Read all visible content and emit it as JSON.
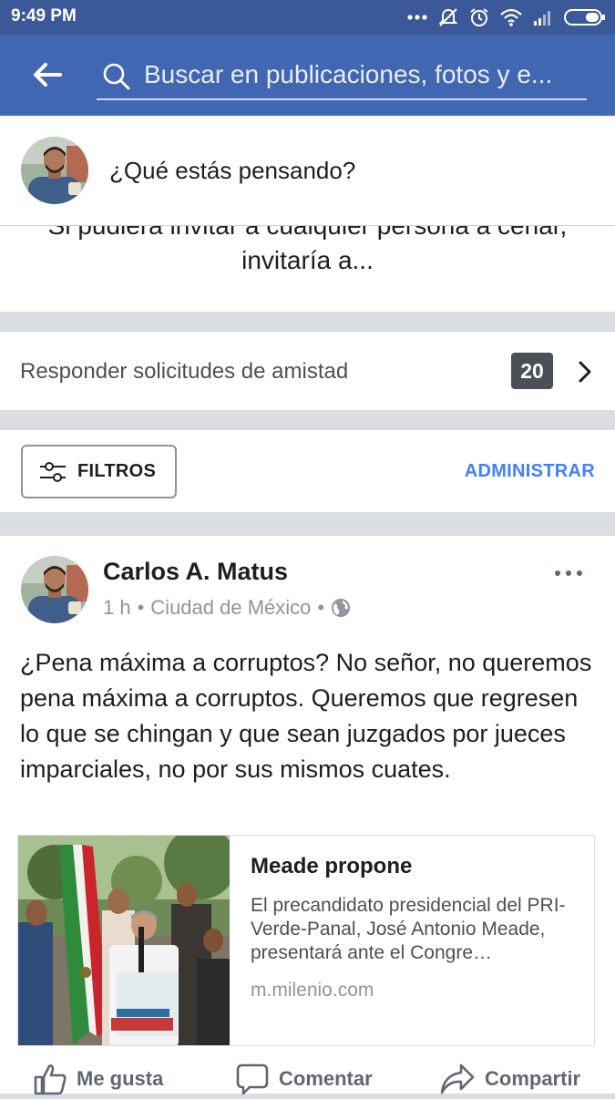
{
  "status_bar": {
    "time": "9:49 PM",
    "icons": [
      "more-dots-icon",
      "mute-icon",
      "alarm-icon",
      "wifi-icon",
      "signal-icon",
      "battery-icon"
    ]
  },
  "header": {
    "search_placeholder": "Buscar en publicaciones, fotos y e...",
    "icons": [
      "back-arrow-icon",
      "search-icon"
    ]
  },
  "composer": {
    "prompt": "¿Qué estás pensando?"
  },
  "prompt_card": {
    "line1": "Si pudiera invitar a cualquier persona a cenar,",
    "line2": "invitaría a..."
  },
  "friend_requests": {
    "label": "Responder solicitudes de amistad",
    "count": "20"
  },
  "filters": {
    "filter_label": "FILTROS",
    "manage_label": "ADMINISTRAR"
  },
  "post": {
    "author": "Carlos A. Matus",
    "time": "1 h",
    "separator": "•",
    "location": "Ciudad de México",
    "text": "¿Pena máxima a corruptos? No señor, no queremos pena máxima a corruptos. Queremos que regresen lo que se chingan y que sean juzgados por jueces imparciales, no por sus mismos cuates.",
    "link": {
      "title": "Meade propone",
      "description": "El precandidato presidencial del PRI-Verde-Panal, José Antonio Meade, presentará ante el Congre…",
      "domain": "m.milenio.com"
    },
    "actions": {
      "like": "Me gusta",
      "comment": "Comentar",
      "share": "Compartir"
    }
  },
  "colors": {
    "brand": "#4267b2",
    "status_bar": "#3b5998",
    "link_accent": "#4080ff",
    "badge": "#4b4f56"
  }
}
